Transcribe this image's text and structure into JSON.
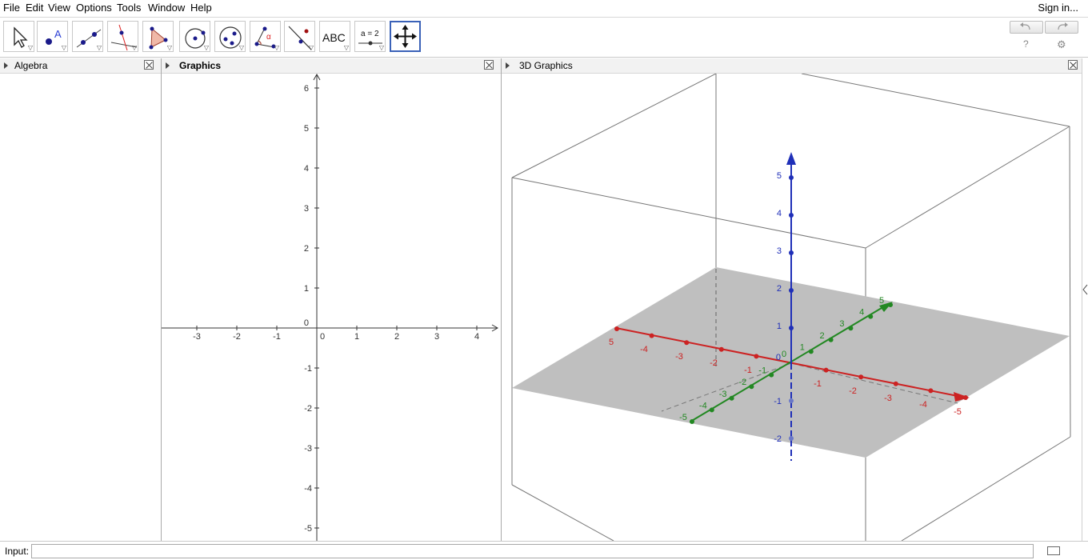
{
  "menu": {
    "items": [
      "File",
      "Edit",
      "View",
      "Options",
      "Tools",
      "Window",
      "Help"
    ],
    "sign_in": "Sign in..."
  },
  "toolbar": {
    "tools": [
      {
        "name": "move",
        "icon": "move-arrow-icon"
      },
      {
        "name": "point",
        "icon": "point-icon"
      },
      {
        "name": "line",
        "icon": "line-through-points-icon"
      },
      {
        "name": "perpendicular",
        "icon": "perpendicular-line-icon"
      },
      {
        "name": "polygon",
        "icon": "polygon-icon"
      },
      {
        "name": "circle",
        "icon": "circle-center-point-icon"
      },
      {
        "name": "ellipse",
        "icon": "ellipse-icon"
      },
      {
        "name": "angle",
        "icon": "angle-icon"
      },
      {
        "name": "reflect",
        "icon": "reflect-line-icon"
      },
      {
        "name": "text",
        "icon": "text-icon",
        "label": "ABC"
      },
      {
        "name": "slider",
        "icon": "slider-icon",
        "label": "a = 2"
      },
      {
        "name": "move-graphics",
        "icon": "move-graphics-view-icon"
      }
    ],
    "selected_tool": "move-graphics"
  },
  "panels": {
    "algebra": {
      "title": "Algebra"
    },
    "graphics": {
      "title": "Graphics"
    },
    "graphics3d": {
      "title": "3D Graphics"
    }
  },
  "graphics2d": {
    "x_ticks": [
      "-3",
      "-2",
      "-1",
      "0",
      "1",
      "2",
      "3",
      "4"
    ],
    "y_ticks_pos": [
      "6",
      "5",
      "4",
      "3",
      "2",
      "1",
      "0"
    ],
    "y_ticks_neg": [
      "-1",
      "-2",
      "-3",
      "-4",
      "-5"
    ]
  },
  "graphics3d": {
    "x_axis_color": "#cc2222",
    "y_axis_color": "#228822",
    "z_axis_color": "#1f2fb8",
    "plane_color": "#c0c0c0",
    "x_labels_front": [
      "5",
      "-4",
      "-3",
      "-2",
      "-1"
    ],
    "x_labels_back": [
      "-1",
      "-2",
      "-3",
      "-4",
      "-5"
    ],
    "y_labels": [
      "-5",
      "-4",
      "-3",
      "-2",
      "-1",
      "0",
      "1",
      "2",
      "3",
      "4",
      "5"
    ],
    "z_labels": [
      "5",
      "4",
      "3",
      "2",
      "1",
      "0",
      "-1",
      "-2"
    ]
  },
  "inputbar": {
    "label": "Input:",
    "value": ""
  }
}
